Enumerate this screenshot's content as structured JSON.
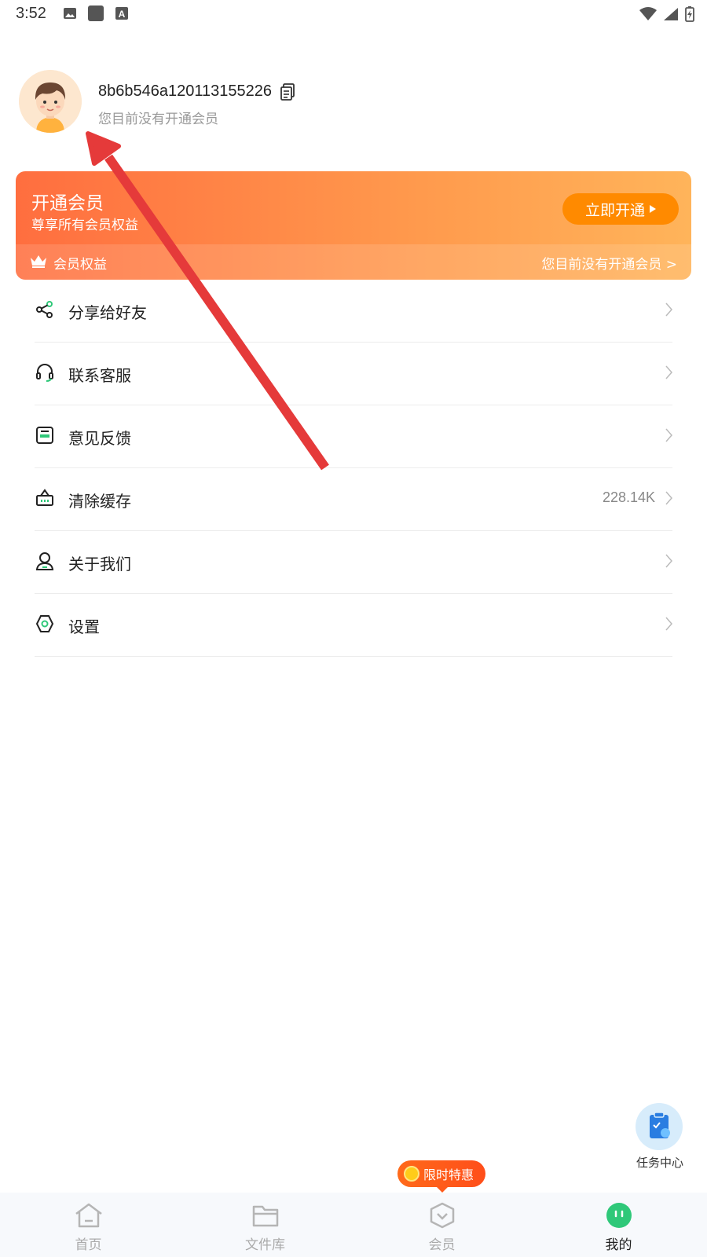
{
  "status_bar": {
    "time": "3:52"
  },
  "profile": {
    "user_id": "8b6b546a120113155226",
    "member_status": "您目前没有开通会员"
  },
  "vip_card": {
    "title": "开通会员",
    "subtitle": "尊享所有会员权益",
    "button_label": "立即开通",
    "benefits_label": "会员权益",
    "status_link": "您目前没有开通会员 >"
  },
  "menu": {
    "items": [
      {
        "label": "分享给好友",
        "icon": "share-icon",
        "value": ""
      },
      {
        "label": "联系客服",
        "icon": "headset-icon",
        "value": ""
      },
      {
        "label": "意见反馈",
        "icon": "feedback-icon",
        "value": ""
      },
      {
        "label": "清除缓存",
        "icon": "basket-icon",
        "value": "228.14K"
      },
      {
        "label": "关于我们",
        "icon": "person-icon",
        "value": ""
      },
      {
        "label": "设置",
        "icon": "hexagon-settings-icon",
        "value": ""
      }
    ]
  },
  "task_center": {
    "label": "任务中心"
  },
  "promo_badge": {
    "label": "限时特惠"
  },
  "bottom_nav": {
    "items": [
      {
        "label": "首页",
        "icon": "home-icon",
        "active": false
      },
      {
        "label": "文件库",
        "icon": "folder-icon",
        "active": false
      },
      {
        "label": "会员",
        "icon": "member-shield-icon",
        "active": false
      },
      {
        "label": "我的",
        "icon": "me-icon",
        "active": true
      }
    ]
  },
  "colors": {
    "accent_green": "#2fc879",
    "vip_orange": "#ff8a00",
    "annotation_arrow": "#e53a3a"
  }
}
